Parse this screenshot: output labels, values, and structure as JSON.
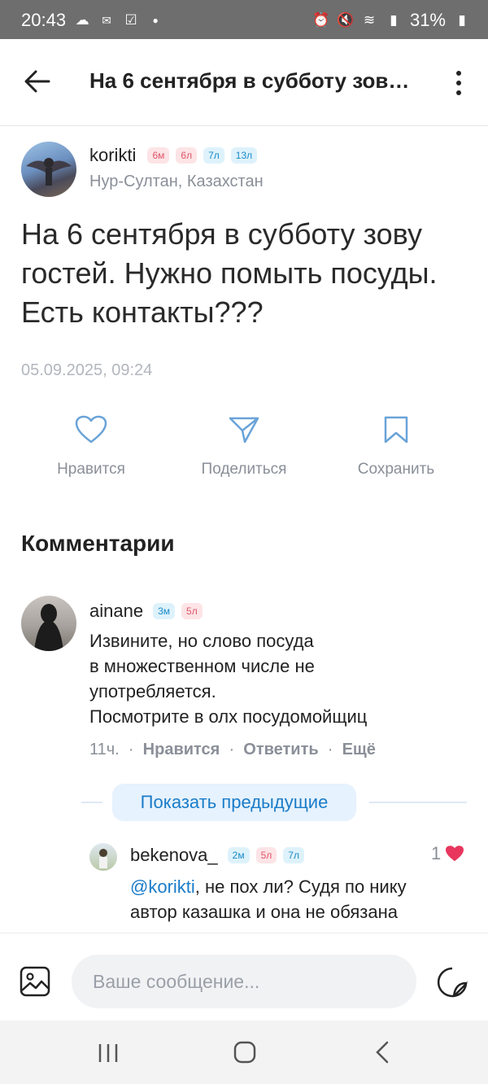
{
  "status_bar": {
    "time": "20:43",
    "battery": "31%"
  },
  "header": {
    "title": "На 6 сентября в субботу зов…"
  },
  "post": {
    "author": "korikti",
    "badges": [
      "6м",
      "6л",
      "7л",
      "13л"
    ],
    "location": "Нур-Султан, Казахстан",
    "text": "На 6 сентября в субботу зову гостей.  Нужно помыть посуды. Есть контакты???",
    "date": "05.09.2025, 09:24"
  },
  "actions": {
    "like": "Нравится",
    "share": "Поделиться",
    "save": "Сохранить"
  },
  "comments_title": "Комментарии",
  "comment1": {
    "author": "ainane",
    "badges": [
      "3м",
      "5л"
    ],
    "lines": [
      "Извините, но слово посуда",
      "в множественном числе не",
      "употребляется.",
      "Посмотрите в олх посудомойщиц"
    ],
    "time": "11ч.",
    "like": "Нравится",
    "reply": "Ответить",
    "more": "Ещё"
  },
  "show_previous": "Показать предыдущие",
  "comment2": {
    "author": "bekenova_",
    "badges": [
      "2м",
      "5л",
      "7л"
    ],
    "mention": "@korikti",
    "line1_rest": ", не пох ли? Судя по нику",
    "line2": "автор казашка и она не обязана",
    "likes": "1"
  },
  "composer": {
    "placeholder": "Ваше сообщение..."
  },
  "colors": {
    "accent": "#1a7cc8",
    "like_heart": "#e8365d",
    "badge_red": "#e0566b",
    "badge_blue": "#1a8bc8"
  }
}
